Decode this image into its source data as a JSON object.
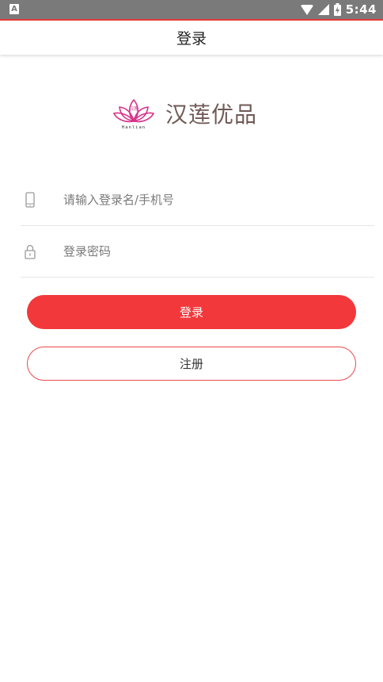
{
  "status_bar": {
    "time": "5:44"
  },
  "header": {
    "title": "登录"
  },
  "logo": {
    "brand_text": "汉莲优品",
    "mark_top": "汉莲",
    "mark_bottom": "Hanlian"
  },
  "form": {
    "username_placeholder": "请输入登录名/手机号",
    "password_placeholder": "登录密码"
  },
  "buttons": {
    "login_label": "登录",
    "register_label": "注册"
  },
  "colors": {
    "primary": "#f2383b",
    "logo_pink": "#d6338a",
    "status_bar": "#7a7a7a"
  }
}
